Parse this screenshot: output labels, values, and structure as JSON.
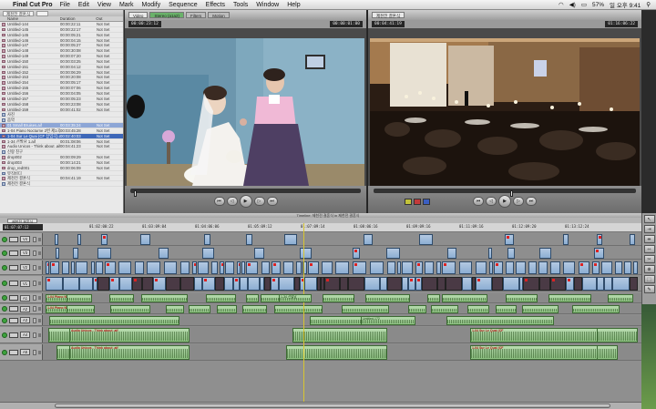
{
  "menubar": {
    "app_name": "Final Cut Pro",
    "items": [
      "File",
      "Edit",
      "View",
      "Mark",
      "Modify",
      "Sequence",
      "Effects",
      "Tools",
      "Window",
      "Help"
    ],
    "battery": "57%",
    "clock": "일 오후 9:41"
  },
  "browser": {
    "tab": "제천전 결혼식",
    "columns": [
      "Name",
      "Duration",
      "Out"
    ],
    "rows": [
      {
        "name": "Untitled-144",
        "duration": "00:00:22:11",
        "out": "Not Set",
        "kind": "clip"
      },
      {
        "name": "Untitled-145",
        "duration": "00:00:22:17",
        "out": "Not Set",
        "kind": "clip"
      },
      {
        "name": "Untitled-145",
        "duration": "00:00:05:21",
        "out": "Not Set",
        "kind": "clip"
      },
      {
        "name": "Untitled-146",
        "duration": "00:00:04:15",
        "out": "Not Set",
        "kind": "clip"
      },
      {
        "name": "Untitled-147",
        "duration": "00:00:05:27",
        "out": "Not Set",
        "kind": "clip"
      },
      {
        "name": "Untitled-148",
        "duration": "00:00:30:08",
        "out": "Not Set",
        "kind": "clip"
      },
      {
        "name": "Untitled-149",
        "duration": "00:00:07:20",
        "out": "Not Set",
        "kind": "clip"
      },
      {
        "name": "Untitled-150",
        "duration": "00:00:03:25",
        "out": "Not Set",
        "kind": "clip"
      },
      {
        "name": "Untitled-151",
        "duration": "00:00:04:12",
        "out": "Not Set",
        "kind": "clip"
      },
      {
        "name": "Untitled-152",
        "duration": "00:00:06:29",
        "out": "Not Set",
        "kind": "clip"
      },
      {
        "name": "Untitled-153",
        "duration": "00:00:20:08",
        "out": "Not Set",
        "kind": "clip"
      },
      {
        "name": "Untitled-154",
        "duration": "00:00:05:17",
        "out": "Not Set",
        "kind": "clip"
      },
      {
        "name": "Untitled-155",
        "duration": "00:00:07:06",
        "out": "Not Set",
        "kind": "clip"
      },
      {
        "name": "Untitled-156",
        "duration": "00:00:04:05",
        "out": "Not Set",
        "kind": "clip"
      },
      {
        "name": "Untitled-157",
        "duration": "00:00:05:23",
        "out": "Not Set",
        "kind": "clip"
      },
      {
        "name": "Untitled-158",
        "duration": "00:00:23:08",
        "out": "Not Set",
        "kind": "clip"
      },
      {
        "name": "Untitled-159",
        "duration": "00:00:41:02",
        "out": "Not Set",
        "kind": "clip"
      },
      {
        "name": "사진",
        "duration": "",
        "out": "",
        "kind": "folder"
      },
      {
        "name": "음악",
        "duration": "",
        "out": "",
        "kind": "folder"
      },
      {
        "name": "01 Small Bruises.aif",
        "duration": "00:03:35:24",
        "out": "Not Set",
        "kind": "clip",
        "state": "sel2"
      },
      {
        "name": "1-04 Piano Nocturne 2번 제1곡 내림 E...",
        "duration": "00:03:45:28",
        "out": "Not Set",
        "kind": "clip"
      },
      {
        "name": "1-04 Sur Le Quai (CF 삽입곡).aif",
        "duration": "00:02:40:03",
        "out": "Not Set",
        "kind": "clip",
        "state": "sel"
      },
      {
        "name": "1-34 선발남 1.aif",
        "duration": "00:01:08:06",
        "out": "Not Set",
        "kind": "clip"
      },
      {
        "name": "Audio Unicos - Think about .aif",
        "duration": "00:04:41:23",
        "out": "Not Set",
        "kind": "clip"
      },
      {
        "name": "신랑 친구",
        "duration": "",
        "out": "",
        "kind": "folder"
      },
      {
        "name": "drop002",
        "duration": "00:00:09:29",
        "out": "Not Set",
        "kind": "clip"
      },
      {
        "name": "drop003",
        "duration": "00:00:14:21",
        "out": "Not Set",
        "kind": "clip"
      },
      {
        "name": "drop_red001",
        "duration": "00:00:06:09",
        "out": "Not Set",
        "kind": "clip"
      },
      {
        "name": "뮤직비디",
        "duration": "",
        "out": "",
        "kind": "folder"
      },
      {
        "name": "제천전 결혼식",
        "duration": "00:04:41:19",
        "out": "Not Set",
        "kind": "clip"
      },
      {
        "name": "제천전 결혼식",
        "duration": "",
        "out": "",
        "kind": "folder"
      }
    ]
  },
  "viewer": {
    "tabs": [
      "Video",
      "Stereo (a1a2)",
      "Filters",
      "Motion"
    ],
    "timecode_left": "00:00:23:12",
    "timecode_right": "00:00:01:00"
  },
  "canvas": {
    "tab": "제천전 결혼식",
    "timecode_left": "00:04:41:19",
    "timecode_right": "01:16:06:22"
  },
  "timeline": {
    "window_title": "Timeline: 제천전 결혼식 in 제천전 결혼식",
    "tab": "제천전 결혼식",
    "current_timecode": "01:07:07:12",
    "ruler_labels": [
      "01:02:00:22",
      "01:03:09:04",
      "01:04:06:06",
      "01:05:09:12",
      "01:07:09:14",
      "01:08:06:16",
      "01:09:09:16",
      "01:11:09:16",
      "01:12:09:20",
      "01:13:12:24",
      "01:14:09:26"
    ],
    "video_tracks": [
      "V4",
      "V3",
      "V2",
      "V1"
    ],
    "audio_tracks": [
      "A1",
      "A2",
      "A3",
      "A4",
      "A5"
    ],
    "audio_clip_labels": [
      "1-04 Piano N",
      "1-34 선발남",
      "Untitled-172",
      "Audio Unicos - Think about .aif",
      "1-04 Sur Le Quai (CF",
      "1-04 Sur Le Quai (CF"
    ]
  },
  "tools": [
    "arrow-tool",
    "select-track-tool",
    "roll-tool",
    "slip-tool",
    "razor-tool",
    "zoom-tool",
    "crop-tool",
    "pen-tool"
  ]
}
